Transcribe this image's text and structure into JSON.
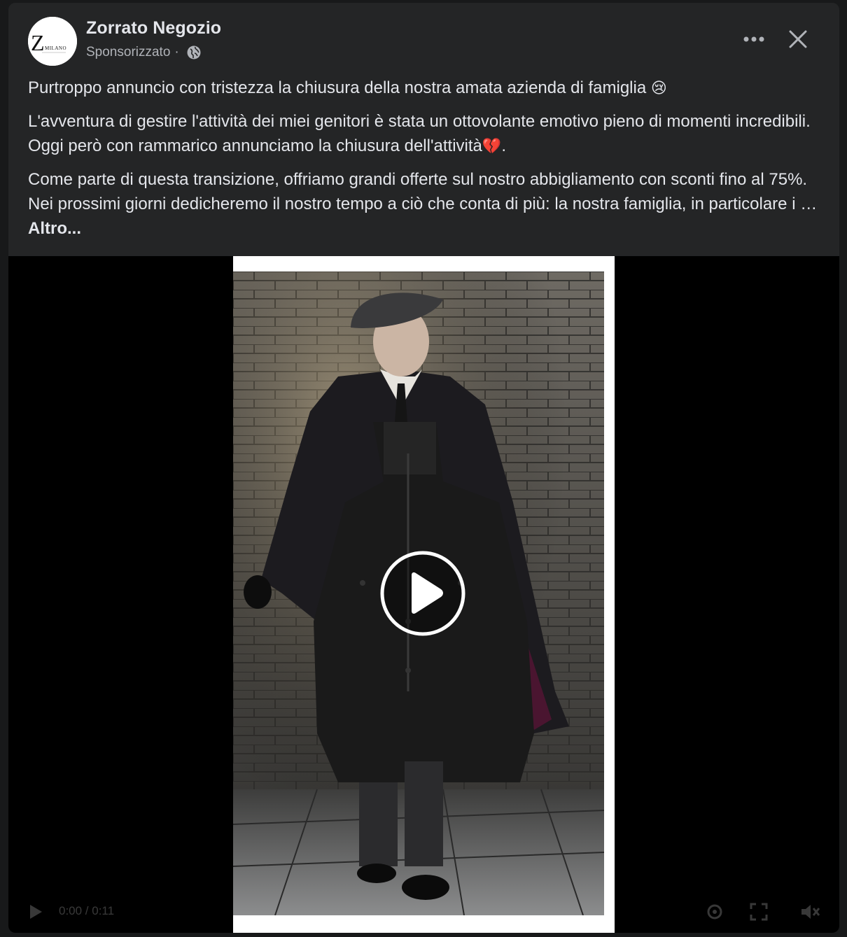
{
  "post": {
    "page_name": "Zorrato Negozio",
    "sponsored_label": "Sponsorizzato",
    "separator": "·",
    "privacy_icon": "globe-icon",
    "avatar_logo_letter": "Z",
    "avatar_logo_text": "MILANO",
    "menu_icon": "more-options-icon",
    "close_icon": "close-icon"
  },
  "text": {
    "paragraph1": "Purtroppo annuncio con tristezza la chiusura della nostra amata azienda di famiglia",
    "paragraph1_emoji": "😢",
    "paragraph2": "L'avventura di gestire l'attività dei miei genitori è stata un ottovolante emotivo pieno di momenti incredibili. Oggi però con rammarico annunciamo la chiusura dell'attività",
    "paragraph2_emoji": "💔",
    "paragraph2_end": ".",
    "paragraph3": "Come parte di questa transizione, offriamo grandi offerte sul nostro abbigliamento con sconti fino al 75%. Nei prossimi giorni dedicheremo il nostro tempo a ciò che conta di più: la nostra famiglia, in particolare i …",
    "see_more": "Altro..."
  },
  "video": {
    "play_icon": "play-icon",
    "time": "0:00 / 0:11",
    "accent": "#ffffff",
    "background": "#000000"
  },
  "colors": {
    "card_bg": "#242526",
    "page_bg": "#18191a",
    "primary_text": "#e4e6eb",
    "secondary_text": "#b0b3b8"
  }
}
